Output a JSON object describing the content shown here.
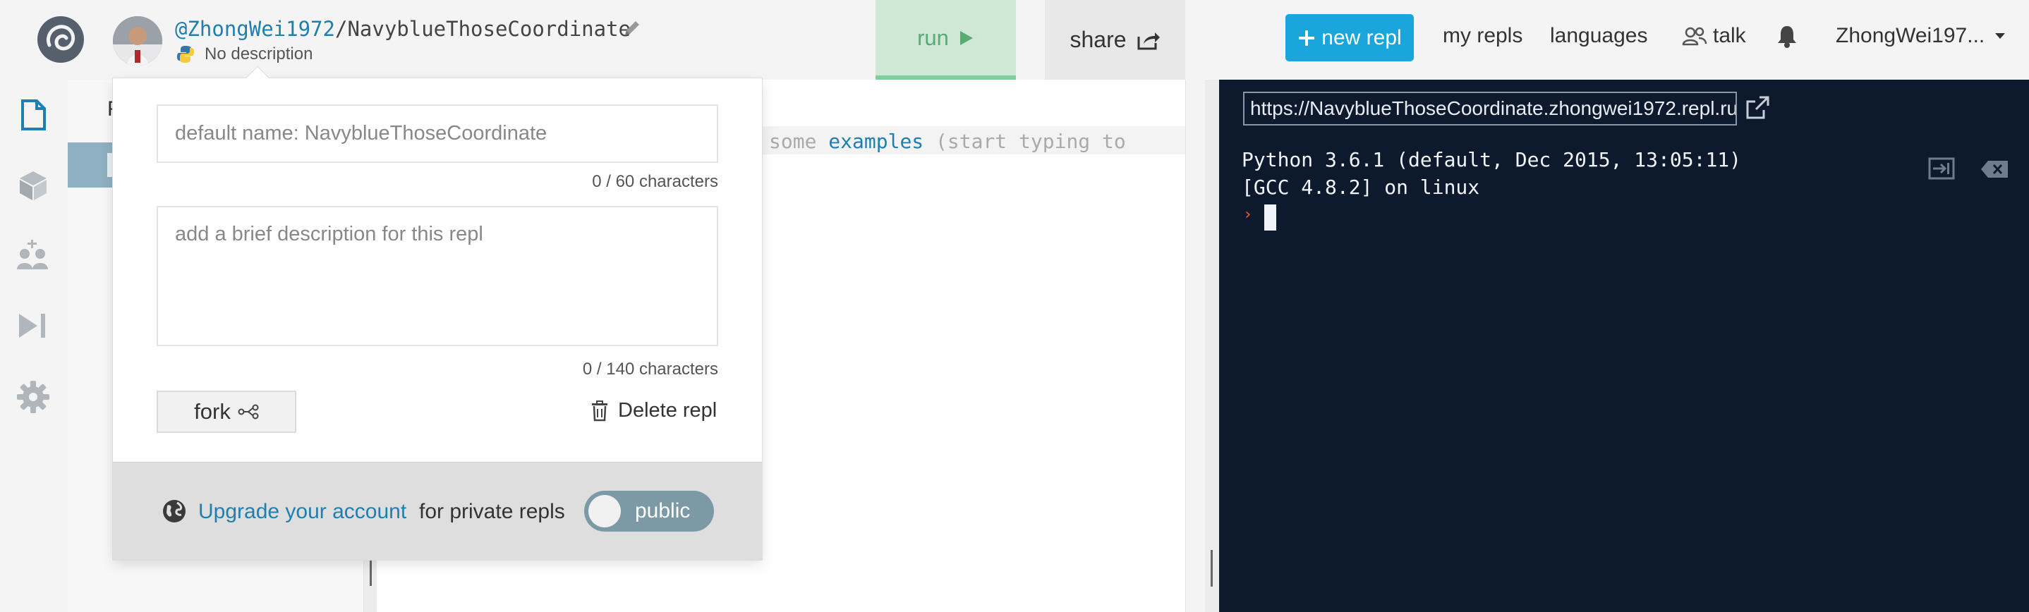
{
  "header": {
    "owner": "@ZhongWei1972",
    "separator": "/",
    "repl_name": "NavyblueThoseCoordinate",
    "description": "No description",
    "run_label": "run",
    "share_label": "share",
    "new_repl_label": "new repl",
    "my_repls_label": "my repls",
    "languages_label": "languages",
    "talk_label": "talk",
    "username": "ZhongWei197..."
  },
  "file_pane": {
    "title": "F"
  },
  "editor": {
    "hint_pre": "some ",
    "hint_kw": "examples",
    "hint_post": " (start typing to"
  },
  "console": {
    "url": "https://NavyblueThoseCoordinate.zhongwei1972.repl.run",
    "output": "Python 3.6.1 (default, Dec 2015, 13:05:11)\n[GCC 4.8.2] on linux",
    "prompt": "›"
  },
  "popup": {
    "name_placeholder": "default name: NavyblueThoseCoordinate",
    "name_count": "0 / 60 characters",
    "desc_placeholder": "add a brief description for this repl",
    "desc_count": "0 / 140 characters",
    "fork_label": "fork",
    "delete_label": "Delete repl",
    "upgrade_link": "Upgrade your account",
    "private_text": "for private repls",
    "visibility_label": "public"
  },
  "colors": {
    "accent": "#1aa5dd",
    "run_bg": "#cfe8d6",
    "console_bg": "#0d1a2d",
    "link": "#1f7fb0",
    "toggle": "#7c9aa6"
  },
  "icons": [
    "replit-logo-icon",
    "pencil-icon",
    "python-icon",
    "play-icon",
    "share-icon",
    "plus-icon",
    "talk-icon",
    "bell-icon",
    "chevron-down-icon",
    "file-icon",
    "package-icon",
    "multiplayer-icon",
    "debugger-icon",
    "settings-icon",
    "open-tab-icon",
    "console-input-icon",
    "clear-console-icon",
    "fork-icon",
    "trash-icon",
    "globe-icon"
  ]
}
